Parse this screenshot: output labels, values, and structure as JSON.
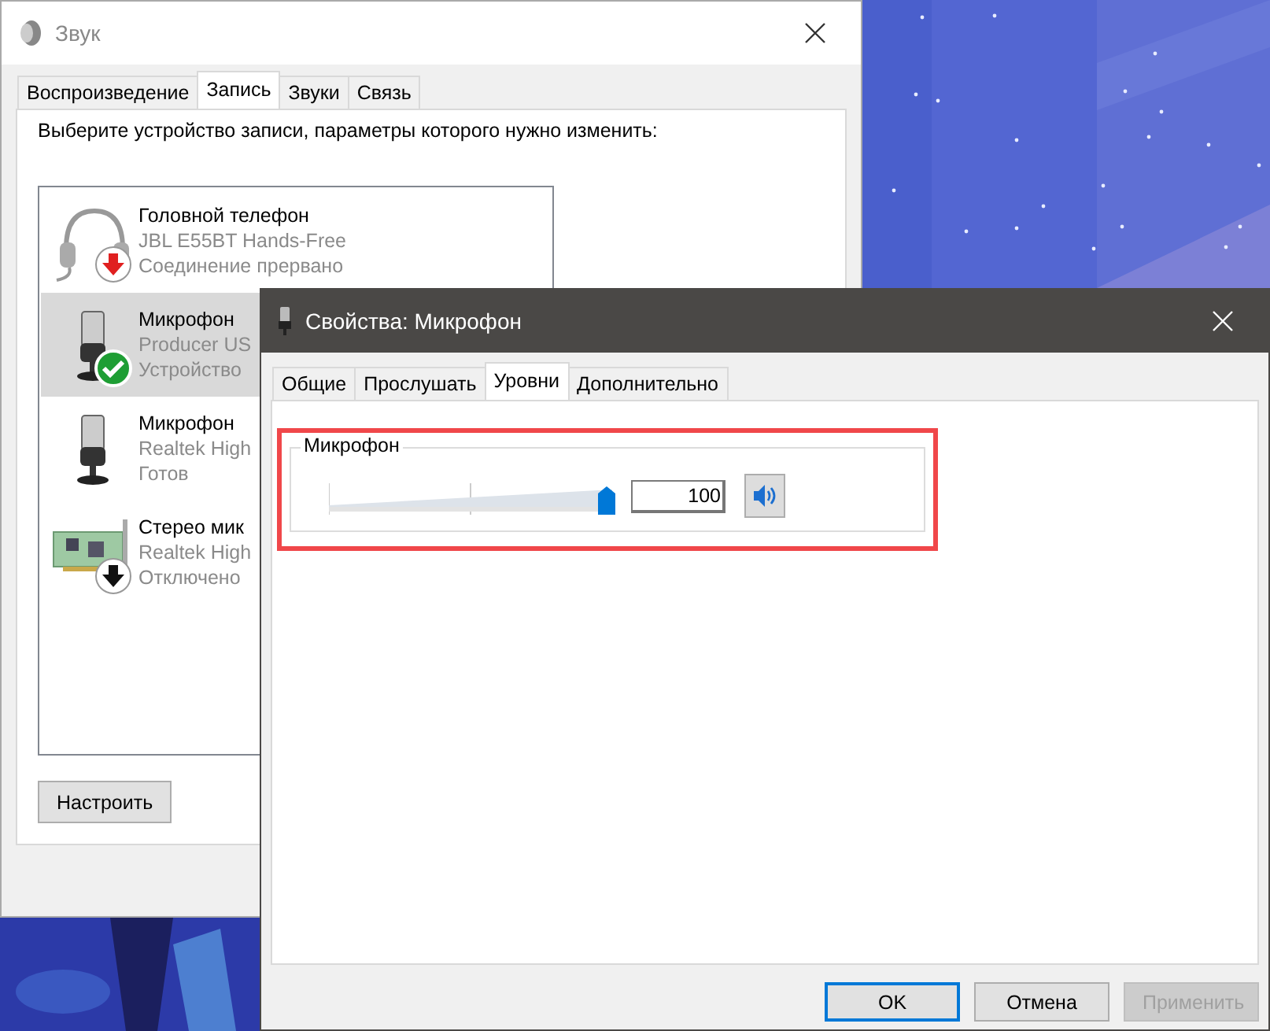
{
  "sound_window": {
    "title": "Звук",
    "tabs": [
      {
        "label": "Воспроизведение",
        "selected": false
      },
      {
        "label": "Запись",
        "selected": true
      },
      {
        "label": "Звуки",
        "selected": false
      },
      {
        "label": "Связь",
        "selected": false
      }
    ],
    "instruction": "Выберите устройство записи, параметры которого нужно изменить:",
    "devices": [
      {
        "kind": "headset",
        "default": false,
        "disconnected": true,
        "disabled": false,
        "name": "Головной телефон",
        "model": "JBL E55BT Hands-Free",
        "status": "Соединение прервано",
        "selected": false
      },
      {
        "kind": "microphone",
        "default": true,
        "disconnected": false,
        "disabled": false,
        "name": "Микрофон",
        "model": "Producer US",
        "status": "Устройство",
        "selected": true
      },
      {
        "kind": "microphone",
        "default": false,
        "disconnected": false,
        "disabled": false,
        "name": "Микрофон",
        "model": "Realtek High",
        "status": "Готов",
        "selected": false
      },
      {
        "kind": "card",
        "default": false,
        "disconnected": false,
        "disabled": true,
        "name": "Стерео мик",
        "model": "Realtek High",
        "status": "Отключено",
        "selected": false
      }
    ],
    "buttons": [
      {
        "label": "Настроить"
      }
    ]
  },
  "properties_dialog": {
    "title": "Свойства: Микрофон",
    "tabs": [
      {
        "label": "Общие",
        "selected": false
      },
      {
        "label": "Прослушать",
        "selected": false
      },
      {
        "label": "Уровни",
        "selected": true
      },
      {
        "label": "Дополнительно",
        "selected": false
      }
    ],
    "levels": [
      {
        "label": "Микрофон",
        "level": 1,
        "value": "100",
        "muted": false,
        "highlighted": true
      }
    ],
    "buttons": [
      {
        "label": "OK",
        "default": true,
        "disabled": false
      },
      {
        "label": "Отмена",
        "default": false,
        "disabled": false
      },
      {
        "label": "Применить",
        "default": false,
        "disabled": true
      }
    ]
  }
}
